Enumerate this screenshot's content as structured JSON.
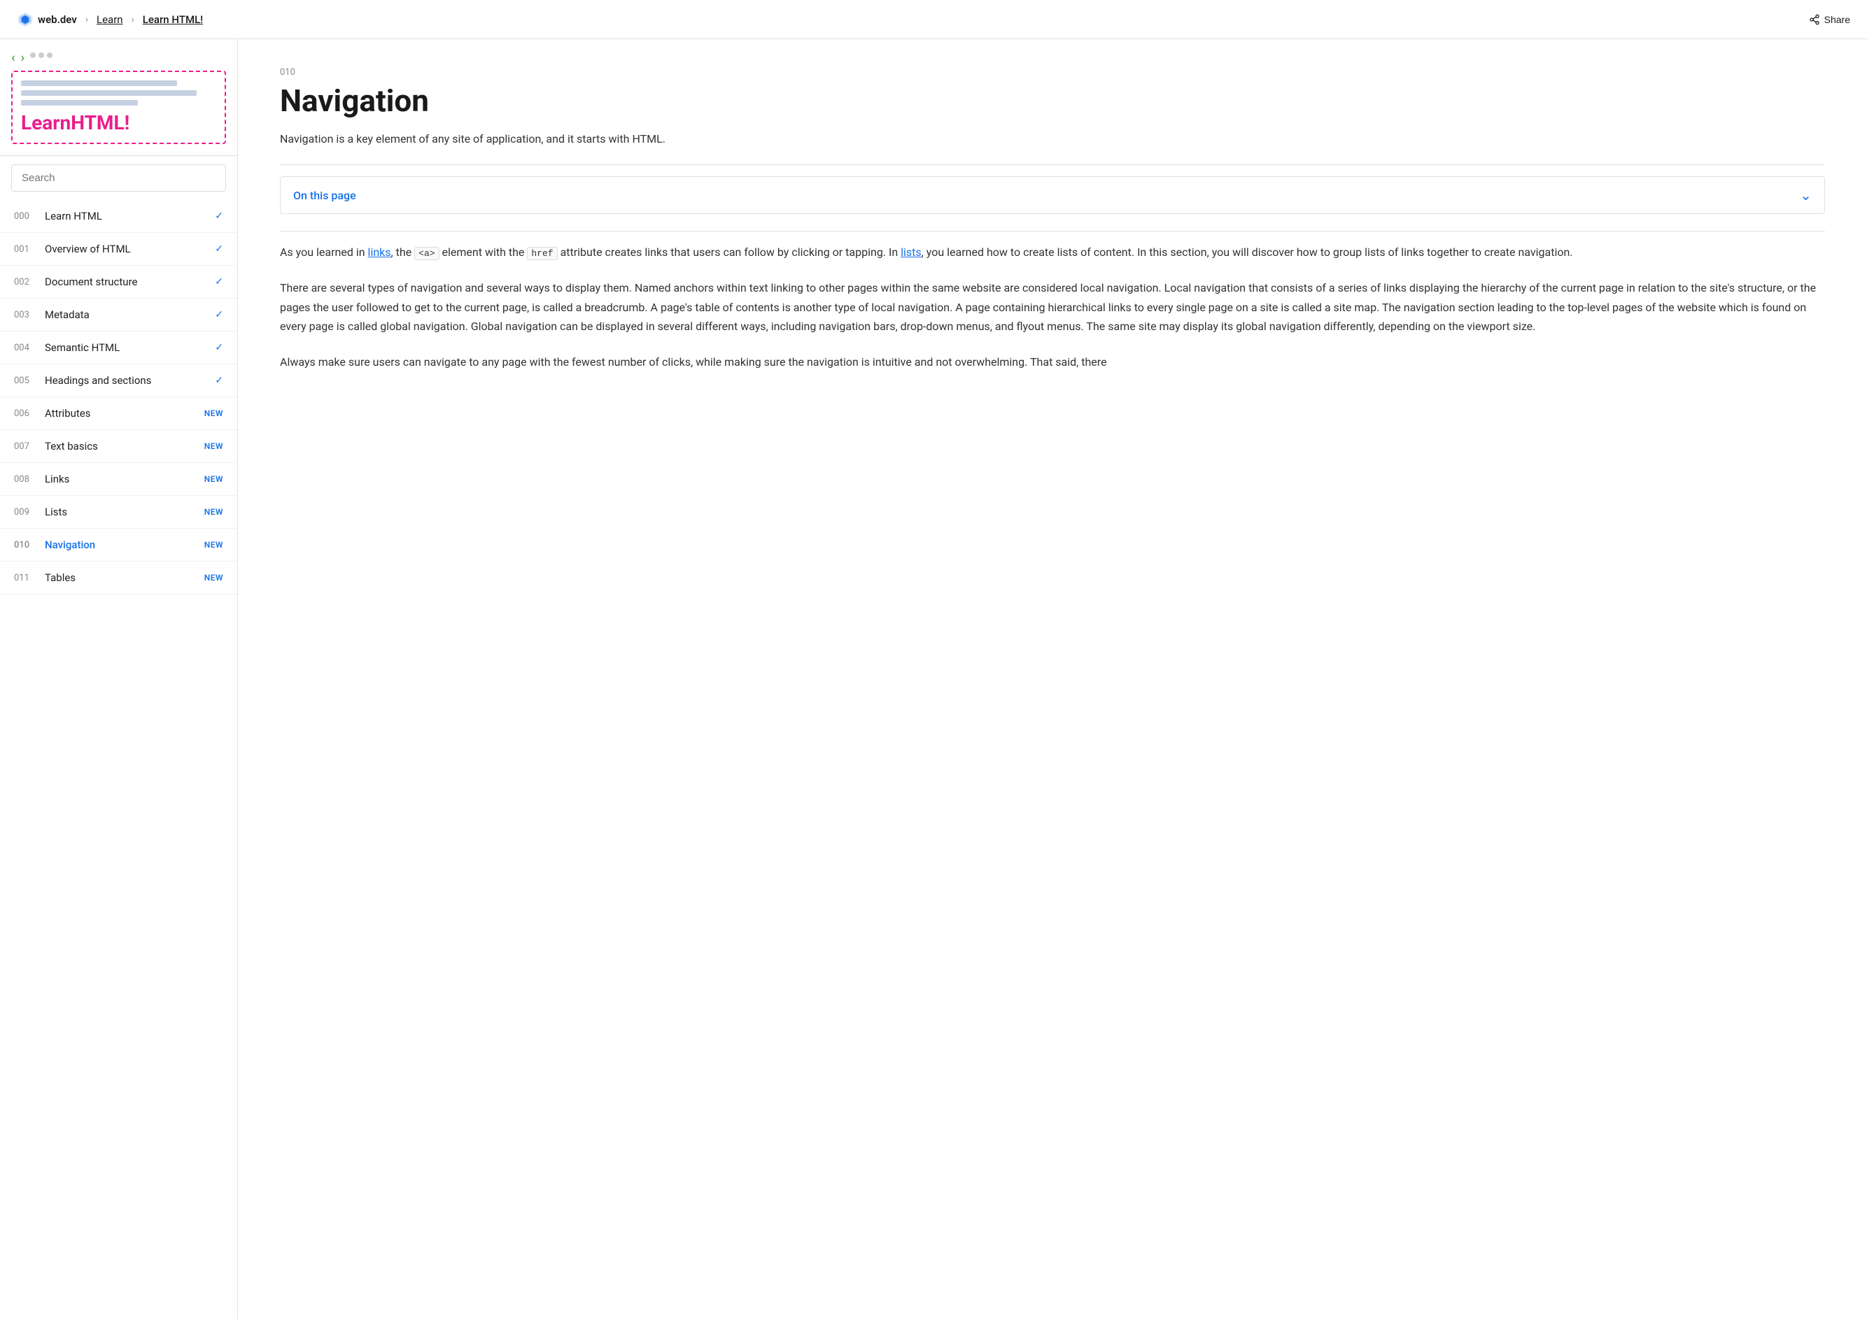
{
  "topnav": {
    "logo_text": "web.dev",
    "breadcrumb1": "Learn",
    "breadcrumb2": "Learn HTML!",
    "share_label": "Share"
  },
  "sidebar": {
    "title_plain": "Learn",
    "title_colored": "HTML!",
    "search_placeholder": "Search",
    "nav_items": [
      {
        "num": "000",
        "label": "Learn HTML",
        "badge": "check",
        "active": false
      },
      {
        "num": "001",
        "label": "Overview of HTML",
        "badge": "check",
        "active": false
      },
      {
        "num": "002",
        "label": "Document structure",
        "badge": "check",
        "active": false
      },
      {
        "num": "003",
        "label": "Metadata",
        "badge": "check",
        "active": false
      },
      {
        "num": "004",
        "label": "Semantic HTML",
        "badge": "check",
        "active": false
      },
      {
        "num": "005",
        "label": "Headings and sections",
        "badge": "check",
        "active": false
      },
      {
        "num": "006",
        "label": "Attributes",
        "badge": "new",
        "active": false
      },
      {
        "num": "007",
        "label": "Text basics",
        "badge": "new",
        "active": false
      },
      {
        "num": "008",
        "label": "Links",
        "badge": "new",
        "active": false
      },
      {
        "num": "009",
        "label": "Lists",
        "badge": "new",
        "active": false
      },
      {
        "num": "010",
        "label": "Navigation",
        "badge": "new",
        "active": true
      },
      {
        "num": "011",
        "label": "Tables",
        "badge": "new",
        "active": false
      }
    ]
  },
  "content": {
    "num": "010",
    "title": "Navigation",
    "subtitle": "Navigation is a key element of any site of application, and it starts with HTML.",
    "on_this_page": "On this page",
    "para1_part1": "As you learned in ",
    "para1_link1": "links",
    "para1_part2": ", the ",
    "para1_code1": "<a>",
    "para1_part3": " element with the ",
    "para1_code2": "href",
    "para1_part4": " attribute creates links that users can follow by clicking or tapping. In ",
    "para1_link2": "lists",
    "para1_part5": ", you learned how to create lists of content. In this section, you will discover how to group lists of links together to create navigation.",
    "para2": "There are several types of navigation and several ways to display them. Named anchors within text linking to other pages within the same website are considered local navigation. Local navigation that consists of a series of links displaying the hierarchy of the current page in relation to the site's structure, or the pages the user followed to get to the current page, is called a breadcrumb. A page's table of contents is another type of local navigation. A page containing hierarchical links to every single page on a site is called a site map. The navigation section leading to the top-level pages of the website which is found on every page is called global navigation. Global navigation can be displayed in several different ways, including navigation bars, drop-down menus, and flyout menus. The same site may display its global navigation differently, depending on the viewport size.",
    "para3_start": "Always make sure users can navigate to any page with the fewest number of clicks, while making sure the navigation is intuitive and not overwhelming. That said, there"
  }
}
